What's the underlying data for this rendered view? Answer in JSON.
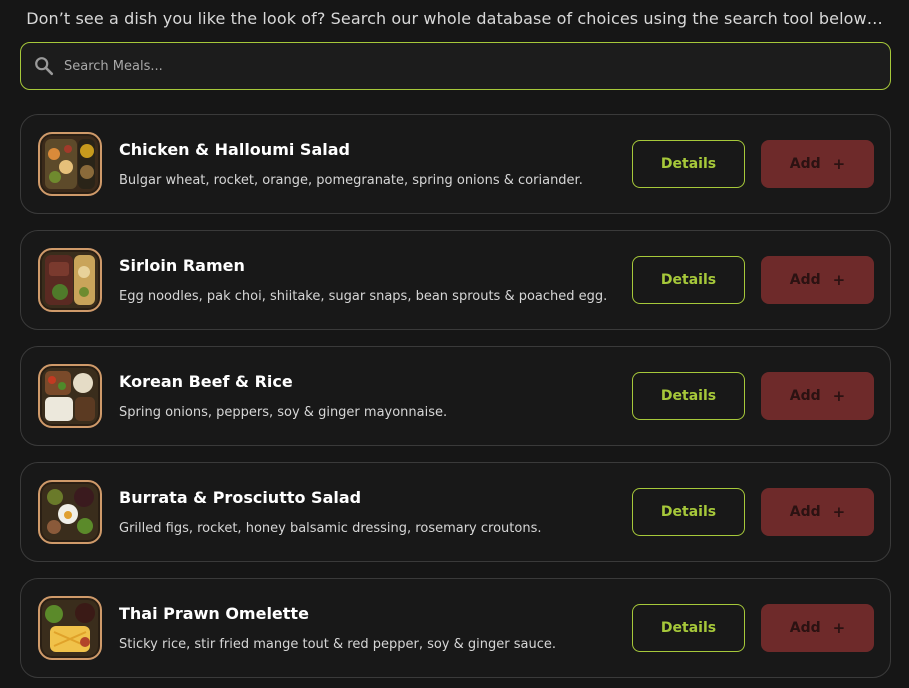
{
  "intro_text": "Don’t see a dish you like the look of? Search our whole database of choices using the search tool below…",
  "search": {
    "placeholder": "Search Meals...",
    "value": ""
  },
  "colors": {
    "accent": "#a6c83a",
    "add_button": "#6e2a2a",
    "background": "#161616"
  },
  "meals": [
    {
      "title": "Chicken & Halloumi Salad",
      "description": "Bulgar wheat, rocket, orange, pomegranate, spring onions & coriander.",
      "details_label": "Details",
      "add_label": "Add"
    },
    {
      "title": "Sirloin Ramen",
      "description": "Egg noodles, pak choi, shiitake, sugar snaps, bean sprouts & poached egg.",
      "details_label": "Details",
      "add_label": "Add"
    },
    {
      "title": "Korean Beef & Rice",
      "description": "Spring onions, peppers, soy & ginger mayonnaise.",
      "details_label": "Details",
      "add_label": "Add"
    },
    {
      "title": "Burrata & Prosciutto Salad",
      "description": "Grilled figs, rocket, honey balsamic dressing, rosemary croutons.",
      "details_label": "Details",
      "add_label": "Add"
    },
    {
      "title": "Thai Prawn Omelette",
      "description": "Sticky rice, stir fried mange tout & red pepper, soy & ginger sauce.",
      "details_label": "Details",
      "add_label": "Add"
    }
  ]
}
